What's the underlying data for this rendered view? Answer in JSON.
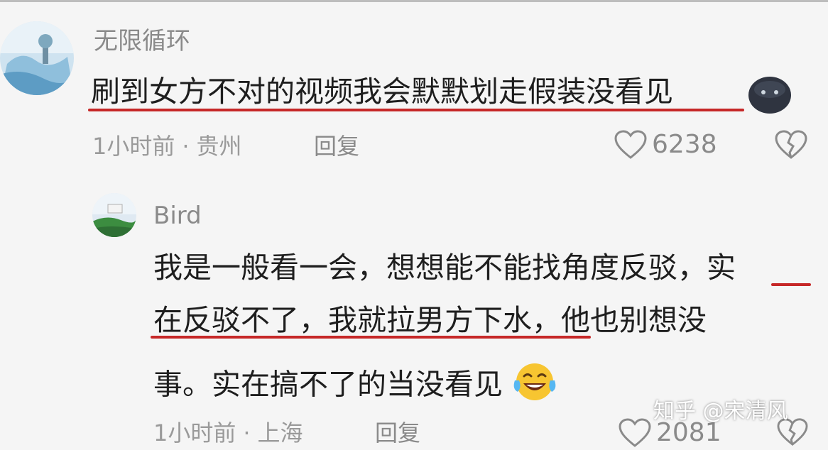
{
  "comment1": {
    "username": "无限循环",
    "text": "刷到女方不对的视频我会默默划走假装没看见",
    "emoji_icon": "dark-blob-emoji",
    "time": "1小时前",
    "separator": "·",
    "location": "贵州",
    "reply_label": "回复",
    "like_count": "6238"
  },
  "comment2": {
    "username": "Bird",
    "line1_plain": "我是一般看一会，想想能不能找角度反驳，",
    "line1_marked": "实",
    "line2_marked": "在反驳不了，我就拉男方下水",
    "line2_plain": "，他也别想没",
    "line3": "事。实在搞不了的当没看见",
    "emoji_icon": "laughing-tears-emoji",
    "time": "1小时前",
    "separator": "·",
    "location": "上海",
    "reply_label": "回复",
    "like_count": "2081"
  },
  "watermark": "知乎 @宋清风",
  "colors": {
    "underline": "#c62828",
    "meta": "#9a9a9a",
    "username": "#8a8a8a",
    "background": "#f5f5f5"
  }
}
